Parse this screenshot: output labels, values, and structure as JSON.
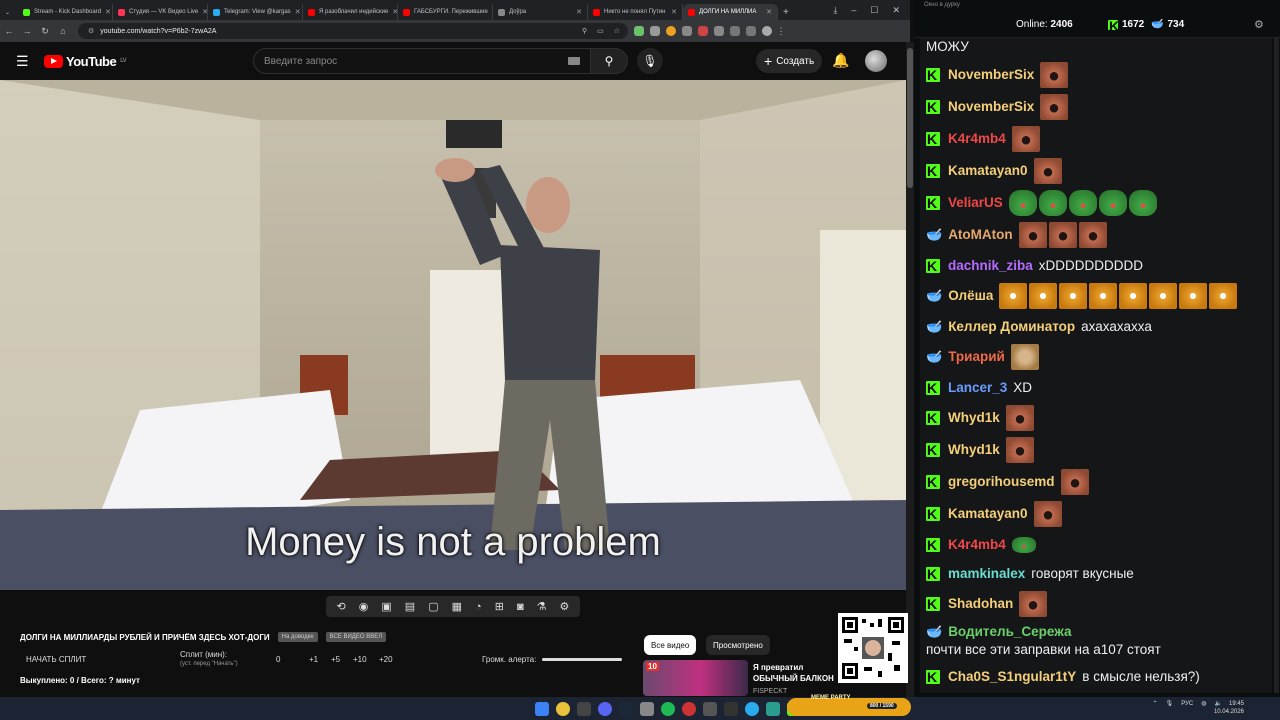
{
  "browser": {
    "tabs": [
      {
        "label": "Stream - Kick Dashboard",
        "color": "#53fc18"
      },
      {
        "label": "Студия — VK Видео Live",
        "color": "#ff3355"
      },
      {
        "label": "Telegram: View @kargas",
        "color": "#2aabee"
      },
      {
        "label": "Я разоблачил индийские",
        "color": "#ff0000"
      },
      {
        "label": "ГАБСБУРГИ. Пережившие",
        "color": "#ff0000"
      },
      {
        "label": "Доўра",
        "color": "#888888"
      },
      {
        "label": "Никто не понял Путин",
        "color": "#ff0000"
      },
      {
        "label": "ДОЛГИ НА МИЛЛИА",
        "color": "#ff0000"
      }
    ],
    "new_tab": "+",
    "url": "youtube.com/watch?v=P6b2-7zwA2A"
  },
  "youtube": {
    "logo_text": "YouTube",
    "region": "LV",
    "search_placeholder": "Введите запрос",
    "create_label": "Создать",
    "subtitle": "Money is not a problem",
    "video_title": "ДОЛГИ НА МИЛЛИАРДЫ РУБЛЕЙ И ПРИЧЁМ ЗДЕСЬ ХОТ-ДОГИ",
    "tag1": "На доводке",
    "tag2": "ВСЕ ВИДЕО ВВЕЛ",
    "start_split": "НАЧАТЬ СПЛИТ",
    "split_label": "Сплит (мин):",
    "split_hint": "(уст. перед \"Начать\")",
    "increments": [
      "0",
      "+1",
      "+5",
      "+10",
      "+20"
    ],
    "volume_label": "Громк. алерта:",
    "bought": "Выкуплено: 0 / Всего: ? минут",
    "tab_all": "Все видео",
    "tab_watched": "Просмотрено",
    "rec_title": "Я превратил ОБЫЧНЫЙ БАЛКОН в ГЕЙМЕРСКУЮ",
    "rec_channel": "FISPECKT",
    "rec_thumb_label": "10"
  },
  "chat": {
    "window_title": "Окно в дурку",
    "online_label": "Online:",
    "online_count": "2406",
    "kick_count": "1672",
    "other_count": "734",
    "top_fragment": "МОЖУ",
    "messages": [
      {
        "badge": "kick",
        "name": "NovemberSix",
        "color": "#f5cf79",
        "text": "",
        "emotes": [
          "face"
        ]
      },
      {
        "badge": "kick",
        "name": "NovemberSix",
        "color": "#f5cf79",
        "text": "",
        "emotes": [
          "face"
        ]
      },
      {
        "badge": "kick",
        "name": "K4r4mb4",
        "color": "#f04848",
        "text": "",
        "emotes": [
          "face"
        ]
      },
      {
        "badge": "kick",
        "name": "Kamatayan0",
        "color": "#f5cf79",
        "text": "",
        "emotes": [
          "face"
        ]
      },
      {
        "badge": "kick",
        "name": "VeliarUS",
        "color": "#f04848",
        "text": "",
        "emotes": [
          "pepe",
          "pepe",
          "pepe",
          "pepe",
          "pepe"
        ]
      },
      {
        "badge": "bowl",
        "name": "AtoMAton",
        "color": "#e6a86b",
        "text": "",
        "emotes": [
          "face",
          "face",
          "face"
        ]
      },
      {
        "badge": "kick",
        "name": "dachnik_ziba",
        "color": "#b66bff",
        "text": "xDDDDDDDDDD",
        "emotes": []
      },
      {
        "badge": "bowl",
        "name": "Олёша",
        "color": "#f5cf79",
        "text": "",
        "emotes": [
          "cat",
          "cat",
          "cat",
          "cat",
          "cat",
          "cat",
          "cat",
          "cat"
        ]
      },
      {
        "badge": "bowl",
        "name": "Келлер Доминатор",
        "color": "#f5cf79",
        "text": "ахахахахха",
        "emotes": []
      },
      {
        "badge": "bowl",
        "name": "Триарий",
        "color": "#f06a48",
        "text": "",
        "emotes": [
          "dog"
        ]
      },
      {
        "badge": "kick",
        "name": "Lancer_3",
        "color": "#6b9bff",
        "text": "XD",
        "emotes": []
      },
      {
        "badge": "kick",
        "name": "Whyd1k",
        "color": "#f5cf79",
        "text": "",
        "emotes": [
          "face"
        ]
      },
      {
        "badge": "kick",
        "name": "Whyd1k",
        "color": "#f5cf79",
        "text": "",
        "emotes": [
          "face"
        ]
      },
      {
        "badge": "kick",
        "name": "gregorihousemd",
        "color": "#f5cf79",
        "text": "",
        "emotes": [
          "face"
        ]
      },
      {
        "badge": "kick",
        "name": "Kamatayan0",
        "color": "#f5cf79",
        "text": "",
        "emotes": [
          "face"
        ]
      },
      {
        "badge": "kick",
        "name": "K4r4mb4",
        "color": "#f04848",
        "text": "",
        "emotes": [
          "pepe-small"
        ]
      },
      {
        "badge": "kick",
        "name": "mamkinalex",
        "color": "#6bdcd0",
        "text": "говорят вкусные",
        "emotes": []
      },
      {
        "badge": "kick",
        "name": "Shadohan",
        "color": "#f5cf79",
        "text": "",
        "emotes": [
          "face"
        ]
      },
      {
        "badge": "bowl",
        "name": "Водитель_Сережа",
        "color": "#6bd06b",
        "text": "почти все эти заправки на а107 стоят",
        "emotes": []
      },
      {
        "badge": "kick",
        "name": "Cha0S_S1ngular1tY",
        "color": "#f5cf79",
        "text": "в смысле нельзя?)",
        "emotes": []
      }
    ]
  },
  "taskbar": {
    "meme_label": "MEME PARTY",
    "meme_progress": "800 / 1590",
    "lang": "РУС",
    "time": "19:45",
    "date": "10.04.2026"
  }
}
